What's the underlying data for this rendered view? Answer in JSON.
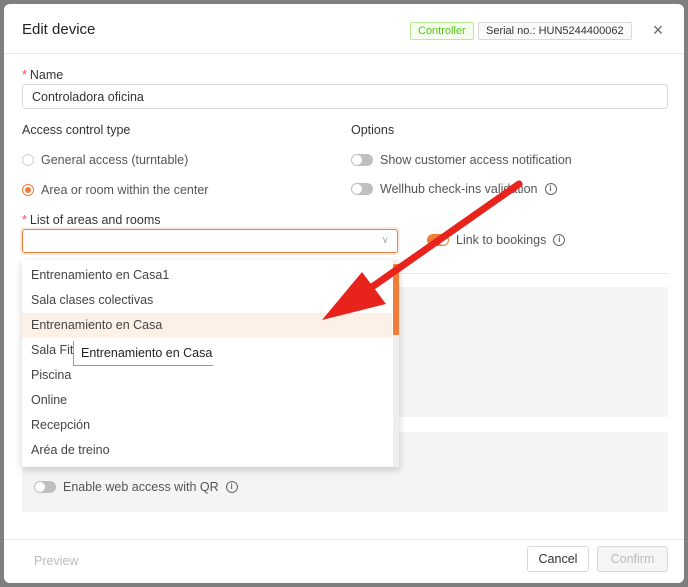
{
  "modal": {
    "title": "Edit device",
    "tag_controller": "Controller",
    "tag_serial": "Serial no.: HUN5244400062",
    "close_icon": "×"
  },
  "name": {
    "label": "Name",
    "required": "*",
    "value": "Controladora oficina"
  },
  "access_type": {
    "label": "Access control type",
    "options": [
      {
        "label": "General access (turntable)",
        "selected": false
      },
      {
        "label": "Area or room within the center",
        "selected": true
      }
    ]
  },
  "options": {
    "label": "Options",
    "toggles": [
      {
        "label": "Show customer access notification",
        "on": false
      },
      {
        "label": "Wellhub check-ins validation",
        "on": false,
        "info": "i"
      },
      {
        "label": "Link to bookings",
        "on": true,
        "info": "i"
      },
      {
        "label": "Enable web access with QR",
        "on": false,
        "info": "i"
      }
    ]
  },
  "areas": {
    "label": "List of areas and rooms",
    "required": "*",
    "chevron": "∨",
    "items": [
      "Entrenamiento en Casa1",
      "Sala clases colectivas",
      "Entrenamiento en Casa",
      "Sala Fit",
      "Piscina",
      "Online",
      "Recepción",
      "Aréa de treino"
    ],
    "tooltip": "Entrenamiento en Casa"
  },
  "footer": {
    "preview": "Preview",
    "cancel": "Cancel",
    "confirm": "Confirm"
  },
  "colors": {
    "accent": "#f07d3a",
    "arrow": "#e8231c",
    "success": "#52c41a"
  }
}
